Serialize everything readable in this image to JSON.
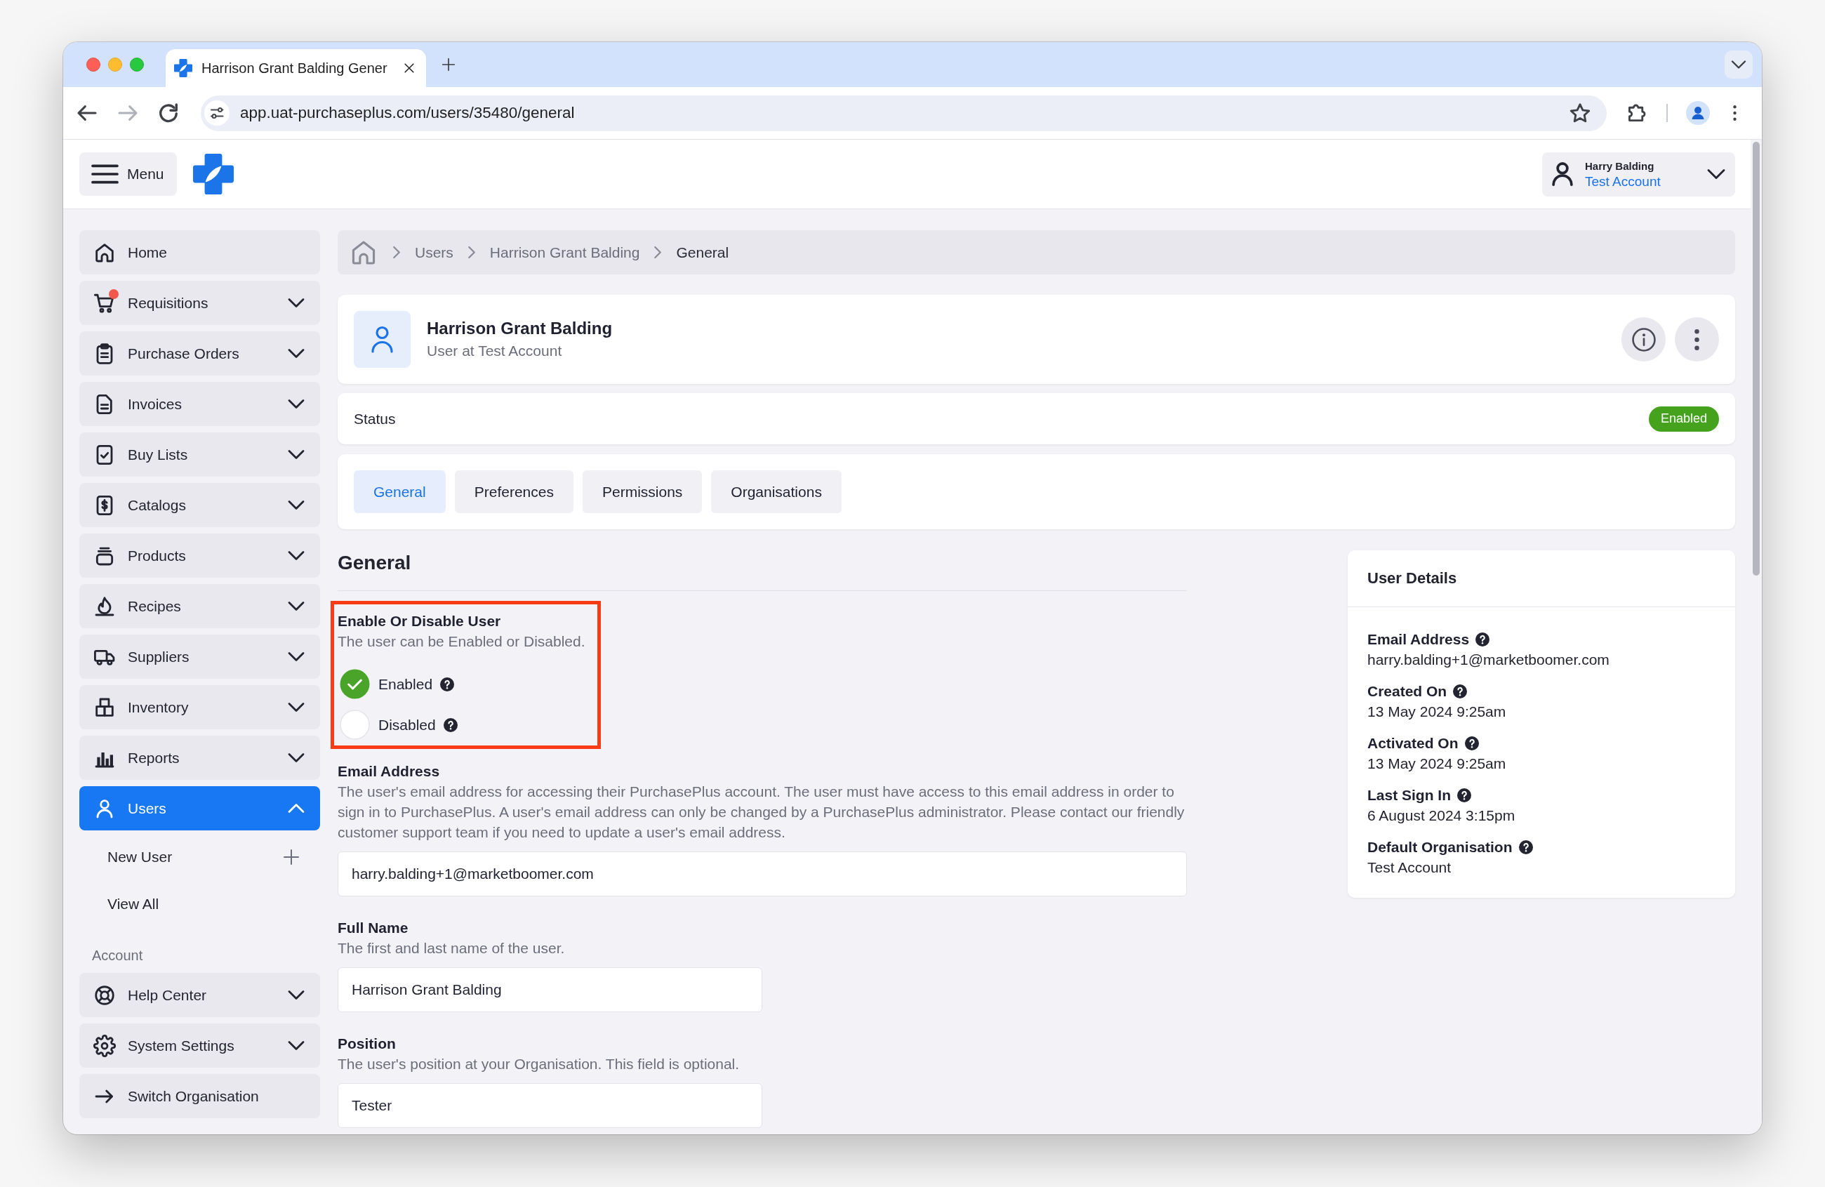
{
  "browser": {
    "tab_title": "Harrison Grant Balding Gener",
    "url": "app.uat-purchaseplus.com/users/35480/general",
    "forward_enabled": false
  },
  "header": {
    "menu_label": "Menu",
    "user_name": "Harry Balding",
    "user_account": "Test Account"
  },
  "sidebar": {
    "items": [
      {
        "label": "Home",
        "kind": "link",
        "selected": false,
        "notification": false
      },
      {
        "label": "Requisitions",
        "kind": "menu",
        "expanded": false,
        "selected": false,
        "notification": true
      },
      {
        "label": "Purchase Orders",
        "kind": "menu",
        "expanded": false,
        "selected": false,
        "notification": false
      },
      {
        "label": "Invoices",
        "kind": "menu",
        "expanded": false,
        "selected": false,
        "notification": false
      },
      {
        "label": "Buy Lists",
        "kind": "menu",
        "expanded": false,
        "selected": false,
        "notification": false
      },
      {
        "label": "Catalogs",
        "kind": "menu",
        "expanded": false,
        "selected": false,
        "notification": false
      },
      {
        "label": "Products",
        "kind": "menu",
        "expanded": false,
        "selected": false,
        "notification": false
      },
      {
        "label": "Recipes",
        "kind": "menu",
        "expanded": false,
        "selected": false,
        "notification": false
      },
      {
        "label": "Suppliers",
        "kind": "menu",
        "expanded": false,
        "selected": false,
        "notification": false
      },
      {
        "label": "Inventory",
        "kind": "menu",
        "expanded": false,
        "selected": false,
        "notification": false
      },
      {
        "label": "Reports",
        "kind": "menu",
        "expanded": false,
        "selected": false,
        "notification": false
      },
      {
        "label": "Users",
        "kind": "menu",
        "expanded": true,
        "selected": true,
        "notification": false,
        "children": [
          {
            "label": "New User",
            "kind": "create"
          },
          {
            "label": "View All",
            "kind": "link"
          }
        ]
      }
    ],
    "account_heading": "Account",
    "account_items": [
      {
        "label": "Help Center",
        "kind": "menu",
        "expanded": false,
        "selected": false
      },
      {
        "label": "System Settings",
        "kind": "menu",
        "expanded": false,
        "selected": false
      },
      {
        "label": "Switch Organisation",
        "kind": "link",
        "selected": false
      }
    ]
  },
  "breadcrumb": [
    {
      "label": "Users",
      "current": false
    },
    {
      "label": "Harrison Grant Balding",
      "current": false
    },
    {
      "label": "General",
      "current": true
    }
  ],
  "profile": {
    "name": "Harrison Grant Balding",
    "subtitle": "User at Test Account"
  },
  "status": {
    "label": "Status",
    "badge": "Enabled"
  },
  "tabs": [
    {
      "label": "General",
      "selected": true
    },
    {
      "label": "Preferences",
      "selected": false
    },
    {
      "label": "Permissions",
      "selected": false
    },
    {
      "label": "Organisations",
      "selected": false
    }
  ],
  "general": {
    "title": "General",
    "fields": [
      {
        "kind": "radio",
        "label": "Enable Or Disable User",
        "description": "The user can be Enabled or Disabled.",
        "highlighted": true,
        "options": [
          {
            "label": "Enabled",
            "selected": true
          },
          {
            "label": "Disabled",
            "selected": false
          }
        ]
      },
      {
        "kind": "email",
        "label": "Email Address",
        "description": "The user's email address for accessing their PurchasePlus account. The user must have access to this email address in order to sign in to PurchasePlus. A user's email address can only be changed by a PurchasePlus administrator. Please contact our friendly customer support team if you need to update a user's email address.",
        "value": "harry.balding+1@marketboomer.com",
        "highlighted": false
      },
      {
        "kind": "text",
        "label": "Full Name",
        "description": "The first and last name of the user.",
        "value": "Harrison Grant Balding",
        "highlighted": false
      },
      {
        "kind": "text",
        "label": "Position",
        "description": "The user's position at your Organisation. This field is optional.",
        "value": "Tester",
        "highlighted": false
      }
    ]
  },
  "user_details": {
    "title": "User Details",
    "items": [
      {
        "label": "Email Address",
        "value": "harry.balding+1@marketboomer.com"
      },
      {
        "label": "Created On",
        "value": "13 May 2024 9:25am"
      },
      {
        "label": "Activated On",
        "value": "13 May 2024 9:25am"
      },
      {
        "label": "Last Sign In",
        "value": "6 August 2024 3:15pm"
      },
      {
        "label": "Default Organisation",
        "value": "Test Account"
      }
    ]
  }
}
